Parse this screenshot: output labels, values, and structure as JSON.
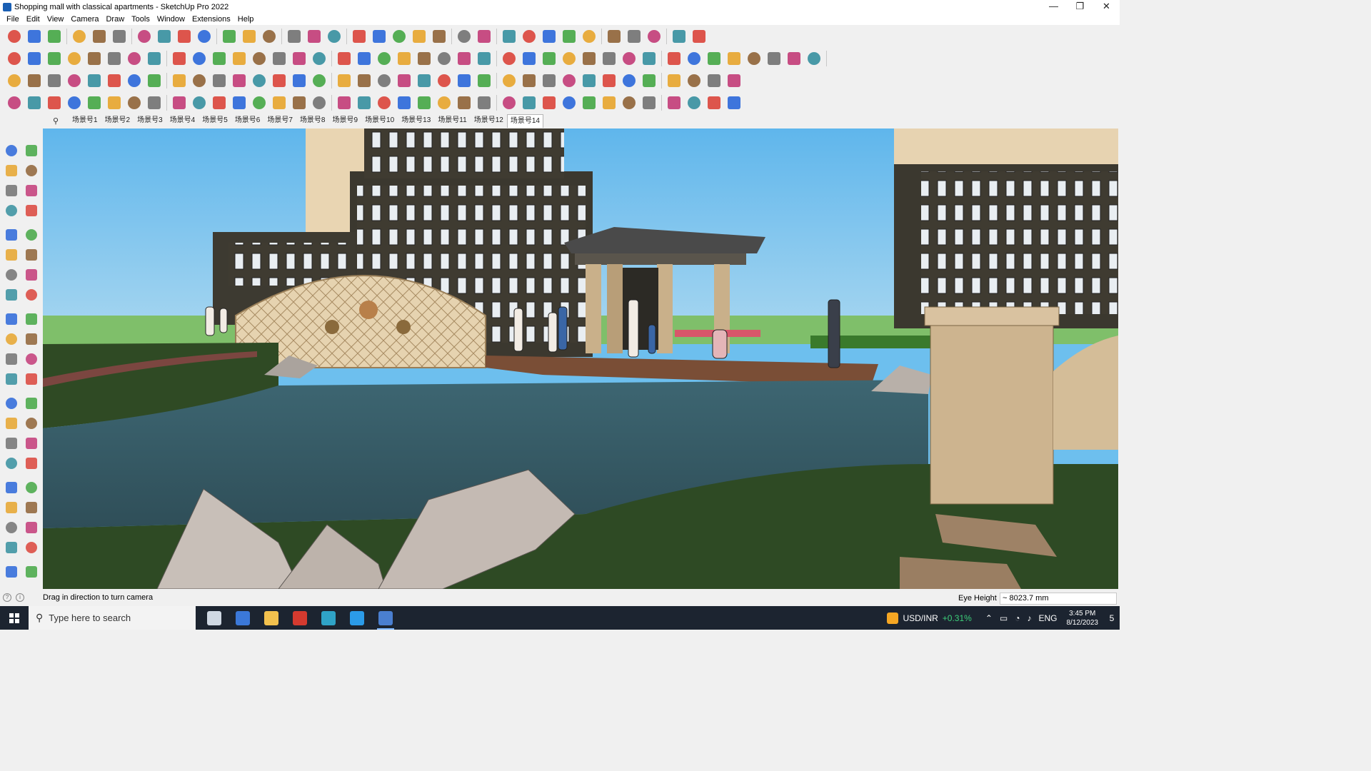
{
  "window": {
    "title": "Shopping mall with classical apartments - SketchUp Pro 2022",
    "controls": {
      "minimize": "—",
      "restore": "❐",
      "close": "✕"
    }
  },
  "menu": [
    "File",
    "Edit",
    "View",
    "Camera",
    "Draw",
    "Tools",
    "Window",
    "Extensions",
    "Help"
  ],
  "scenes": {
    "tabs": [
      "场景号1",
      "场景号2",
      "场景号3",
      "场景号4",
      "场景号5",
      "场景号6",
      "场景号7",
      "场景号8",
      "场景号9",
      "场景号10",
      "场景号13",
      "场景号11",
      "场景号12",
      "场景号14"
    ],
    "active": "场景号14"
  },
  "colors": {
    "sky": "#6dbfee",
    "grass": "#2e4a24",
    "water": "#3a5a66",
    "facade_light": "#e8d2b0",
    "facade_dark": "#3d3a30",
    "stone": "#c9b08a",
    "rock": "#c8bfb8",
    "accent_red": "#d93a2f",
    "accent_blue": "#1f5fd8",
    "accent_green": "#3aa23a"
  },
  "toolbar_icons": {
    "row1": [
      "zoom-icon",
      "select-icon",
      "eraser-icon",
      "pencil-line-icon",
      "lasso-icon",
      "paint-icon",
      "pushpull-icon",
      "followme-icon",
      "move-icon",
      "rotate-icon",
      "scale-icon",
      "tape-icon",
      "text-icon",
      "paint-bucket-icon",
      "orbit-icon",
      "pan-icon",
      "zoom-window-icon",
      "zoom-extents-icon",
      "section-icon",
      "section-fill-icon",
      "layers-icon",
      "styles-icon",
      "user-icon",
      "components-icon",
      "materials-icon",
      "outliner-icon",
      "sort-up-icon",
      "sort-down-icon",
      "dimension-icon",
      "axes-icon",
      "undo-icon",
      "redo-icon",
      "hand-icon"
    ],
    "row2_count": 40,
    "row3_count": 36,
    "row4_count": 36
  },
  "left_tools": [
    "select-icon",
    "orbit-icon",
    "paint-bucket-icon",
    "eraser-icon",
    "component-icon",
    "tape-icon",
    "line-icon",
    "freehand-icon",
    "rectangle-icon",
    "rotated-rect-icon",
    "circle-icon",
    "polygon-icon",
    "arc-icon",
    "pie-icon",
    "arc3-icon",
    "arc2-icon",
    "move-icon",
    "pushpull-icon",
    "rotate-icon",
    "followme-icon",
    "scale-icon",
    "offset-icon",
    "tape-measure-icon",
    "dimension-icon",
    "protractor-icon",
    "text-icon",
    "axes-icon",
    "3dtext-icon",
    "orbit-tool-icon",
    "pan-icon",
    "zoom-icon",
    "zoom-window-icon",
    "zoom-extents-icon",
    "previous-icon",
    "walk-icon",
    "lookaround-icon",
    "footprint-icon",
    "position-camera-icon",
    "section-plane-icon",
    "section-fill-icon",
    "display-section-icon",
    "section-cuts-icon"
  ],
  "status": {
    "message": "Drag in direction to turn camera",
    "vcb_label": "Eye Height",
    "vcb_value": "~ 8023.7 mm"
  },
  "taskbar": {
    "search_placeholder": "Type here to search",
    "apps": [
      "task-view-icon",
      "calculator-icon",
      "file-explorer-icon",
      "acrobat-icon",
      "app-store-icon",
      "edge-icon",
      "sketchup-icon"
    ],
    "ticker": "USD/INR",
    "ticker_change": "+0.31%",
    "language": "ENG",
    "time": "3:45 PM",
    "date": "8/12/2023",
    "notifications": "5"
  }
}
